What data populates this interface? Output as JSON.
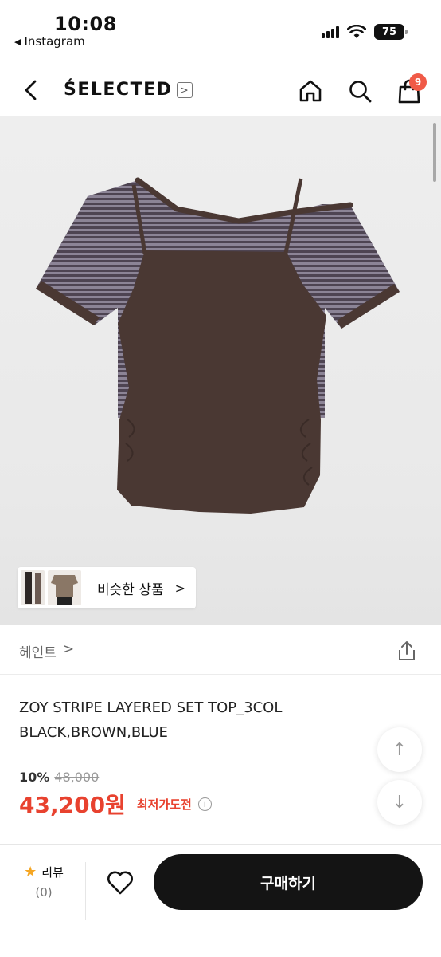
{
  "status_bar": {
    "time": "10:08",
    "back_app": "Instagram",
    "battery": "75"
  },
  "header": {
    "brand": "ŚELECTED",
    "brand_arrow": ">",
    "icons": [
      "back-chevron-icon",
      "home-icon",
      "search-icon",
      "shopping-bag-icon"
    ],
    "cart_count": "9"
  },
  "hero": {
    "similar_label": "비슷한 상품",
    "similar_chevron": ">"
  },
  "product": {
    "brand": "헤인트",
    "brand_chevron": ">",
    "title_line1": "ZOY STRIPE LAYERED SET TOP_3COL",
    "title_line2": "BLACK,BROWN,BLUE",
    "discount": "10%",
    "original_price": "48,000",
    "price": "43,200원",
    "lowest_label": "최저가도전",
    "info_glyph": "i"
  },
  "float_buttons": {
    "up": "↑",
    "down": "↓"
  },
  "bottom_bar": {
    "review_label": "리뷰",
    "review_count": "(0)",
    "buy_label": "구매하기"
  },
  "colors": {
    "accent_red": "#e8422f",
    "badge": "#f05a47",
    "buy_button": "#141414",
    "shirt_brown": "#4a3833"
  }
}
